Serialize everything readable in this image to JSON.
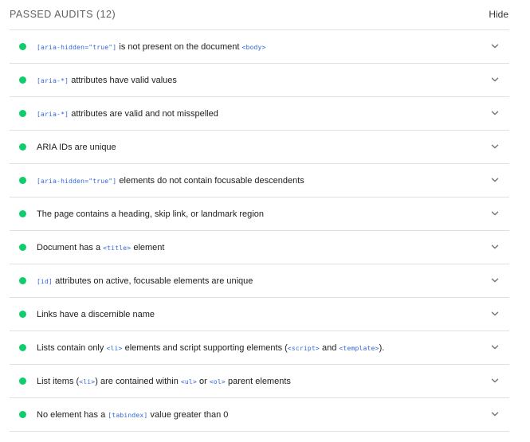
{
  "section": {
    "title": "PASSED AUDITS",
    "count": "(12)",
    "hide_label": "Hide"
  },
  "colors": {
    "pass": "#0cce6b",
    "code": "#3367d6",
    "divider": "#e0e0e0"
  },
  "icons": {
    "status": "pass-circle-icon",
    "expand": "chevron-down-icon"
  },
  "audits": [
    {
      "id": "aria-hidden-body",
      "parts": [
        {
          "t": "[aria-hidden=\"true\"]",
          "code": true
        },
        {
          "t": " is not present on the document "
        },
        {
          "t": "<body>",
          "code": true
        }
      ]
    },
    {
      "id": "aria-valid-attr-value",
      "parts": [
        {
          "t": "[aria-*]",
          "code": true
        },
        {
          "t": " attributes have valid values"
        }
      ]
    },
    {
      "id": "aria-valid-attr",
      "parts": [
        {
          "t": "[aria-*]",
          "code": true
        },
        {
          "t": " attributes are valid and not misspelled"
        }
      ]
    },
    {
      "id": "duplicate-id-aria",
      "parts": [
        {
          "t": "ARIA IDs are unique"
        }
      ]
    },
    {
      "id": "aria-hidden-focus",
      "parts": [
        {
          "t": "[aria-hidden=\"true\"]",
          "code": true
        },
        {
          "t": " elements do not contain focusable descendents"
        }
      ]
    },
    {
      "id": "bypass",
      "parts": [
        {
          "t": "The page contains a heading, skip link, or landmark region"
        }
      ]
    },
    {
      "id": "document-title",
      "parts": [
        {
          "t": "Document has a "
        },
        {
          "t": "<title>",
          "code": true
        },
        {
          "t": " element"
        }
      ]
    },
    {
      "id": "duplicate-id-active",
      "parts": [
        {
          "t": "[id]",
          "code": true
        },
        {
          "t": " attributes on active, focusable elements are unique"
        }
      ]
    },
    {
      "id": "link-name",
      "parts": [
        {
          "t": "Links have a discernible name"
        }
      ]
    },
    {
      "id": "list",
      "parts": [
        {
          "t": "Lists contain only "
        },
        {
          "t": "<li>",
          "code": true
        },
        {
          "t": " elements and script supporting elements ("
        },
        {
          "t": "<script>",
          "code": true
        },
        {
          "t": " and "
        },
        {
          "t": "<template>",
          "code": true
        },
        {
          "t": ")."
        }
      ]
    },
    {
      "id": "listitem",
      "parts": [
        {
          "t": "List items ("
        },
        {
          "t": "<li>",
          "code": true
        },
        {
          "t": ") are contained within "
        },
        {
          "t": "<ul>",
          "code": true
        },
        {
          "t": " or "
        },
        {
          "t": "<ol>",
          "code": true
        },
        {
          "t": " parent elements"
        }
      ]
    },
    {
      "id": "tabindex",
      "parts": [
        {
          "t": "No element has a "
        },
        {
          "t": "[tabindex]",
          "code": true
        },
        {
          "t": " value greater than 0"
        }
      ]
    }
  ]
}
